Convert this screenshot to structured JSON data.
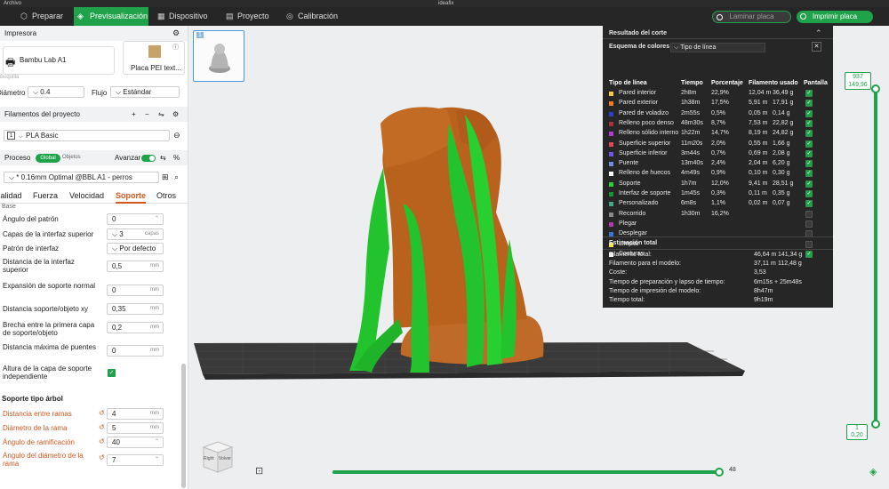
{
  "titlebar": {
    "archivo": "Archivo",
    "app": "ideafix"
  },
  "tabs": [
    {
      "label": "Preparar",
      "icon": "cube-icon"
    },
    {
      "label": "Previsualización",
      "icon": "preview-icon"
    },
    {
      "label": "Dispositivo",
      "icon": "device-icon"
    },
    {
      "label": "Proyecto",
      "icon": "project-icon"
    },
    {
      "label": "Calibración",
      "icon": "calibration-icon"
    }
  ],
  "actions": {
    "slice": "Laminar placa",
    "print": "Imprimir placa"
  },
  "printer": {
    "section": "Impresora",
    "name": "Bambu Lab A1",
    "plate": "Placa PEI text...",
    "nozzle_label": "Diámetro",
    "nozzle_value": "0.4",
    "flow_label": "Flujo",
    "flow_value": "Estándar",
    "boquilla": "Boquilla"
  },
  "filaments": {
    "section": "Filamentos del proyecto",
    "item_num": "1",
    "item": "PLA Basic"
  },
  "process": {
    "section": "Proceso",
    "global": "Global",
    "objects": "Objetos",
    "advanced": "Avanzar",
    "preset": "* 0.16mm Optimal @BBL A1 - perros",
    "tabs": [
      "Calidad",
      "Fuerza",
      "Velocidad",
      "Soporte",
      "Otros"
    ],
    "base": "Base",
    "fields": [
      {
        "label": "Ángulo del patrón",
        "value": "0",
        "unit": ""
      },
      {
        "label": "Capas de la interfaz superior",
        "value": "3",
        "unit": "capas"
      },
      {
        "label": "Patrón de interfaz",
        "value": "Por defecto",
        "unit": ""
      },
      {
        "label": "Distancia de la interfaz superior",
        "value": "0,5",
        "unit": "mm"
      },
      {
        "label": "Expansión de soporte normal",
        "value": "0",
        "unit": "mm"
      },
      {
        "label": "Distancia soporte/objeto xy",
        "value": "0,35",
        "unit": "mm"
      },
      {
        "label": "Brecha entre la primera capa de soporte/objeto",
        "value": "0,2",
        "unit": "mm"
      },
      {
        "label": "Distancia máxima de puentes",
        "value": "0",
        "unit": "mm"
      },
      {
        "label": "Altura de la capa de soporte independiente",
        "value": "",
        "unit": ""
      }
    ],
    "tree_section": "Soporte tipo árbol",
    "tree": [
      {
        "label": "Distancia entre ramas",
        "value": "4",
        "unit": "mm"
      },
      {
        "label": "Diámetro de la rama",
        "value": "5",
        "unit": "mm"
      },
      {
        "label": "Ángulo de ramificación",
        "value": "40",
        "unit": "°"
      },
      {
        "label": "Ángulo del diámetro de la rama",
        "value": "7",
        "unit": "°"
      }
    ]
  },
  "plate_num": "1",
  "cube": {
    "right": "Right",
    "volver": "Volver"
  },
  "result": {
    "title": "Resultado del corte",
    "scheme_label": "Esquema de colores",
    "scheme_value": "Tipo de línea",
    "columns": [
      "Tipo de línea",
      "Tiempo",
      "Porcentaje",
      "Filamento usado",
      "Pantalla"
    ],
    "rows": [
      {
        "name": "Pared interior",
        "time": "2h8m",
        "pct": "22,9%",
        "len": "12,04 m",
        "g": "36,49 g",
        "color": "#f5c842",
        "on": true
      },
      {
        "name": "Pared exterior",
        "time": "1h38m",
        "pct": "17,5%",
        "len": "5,91 m",
        "g": "17,91 g",
        "color": "#f07c24",
        "on": true
      },
      {
        "name": "Pared de voladizo",
        "time": "2m55s",
        "pct": "0,5%",
        "len": "0,05 m",
        "g": "0,14 g",
        "color": "#2c3fc7",
        "on": true
      },
      {
        "name": "Relleno poco denso",
        "time": "48m30s",
        "pct": "8,7%",
        "len": "7,53 m",
        "g": "22,82 g",
        "color": "#a8323a",
        "on": true
      },
      {
        "name": "Relleno sólido interno",
        "time": "1h22m",
        "pct": "14,7%",
        "len": "8,19 m",
        "g": "24,82 g",
        "color": "#b23bd1",
        "on": true
      },
      {
        "name": "Superficie superior",
        "time": "11m20s",
        "pct": "2,0%",
        "len": "0,55 m",
        "g": "1,66 g",
        "color": "#e0495a",
        "on": true
      },
      {
        "name": "Superficie inferior",
        "time": "3m44s",
        "pct": "0,7%",
        "len": "0,69 m",
        "g": "2,08 g",
        "color": "#7057e3",
        "on": true
      },
      {
        "name": "Puente",
        "time": "13m40s",
        "pct": "2,4%",
        "len": "2,04 m",
        "g": "6,20 g",
        "color": "#6f8fdc",
        "on": true
      },
      {
        "name": "Relleno de huecos",
        "time": "4m49s",
        "pct": "0,9%",
        "len": "0,10 m",
        "g": "0,30 g",
        "color": "#ffffff",
        "on": true
      },
      {
        "name": "Soporte",
        "time": "1h7m",
        "pct": "12,0%",
        "len": "9,41 m",
        "g": "28,51 g",
        "color": "#2fcc3a",
        "on": true
      },
      {
        "name": "Interfaz de soporte",
        "time": "1m45s",
        "pct": "0,3%",
        "len": "0,11 m",
        "g": "0,35 g",
        "color": "#1f8f3a",
        "on": true
      },
      {
        "name": "Personalizado",
        "time": "6m8s",
        "pct": "1,1%",
        "len": "0,02 m",
        "g": "0,07 g",
        "color": "#4aa38a",
        "on": true
      },
      {
        "name": "Recorrido",
        "time": "1h30m",
        "pct": "16,2%",
        "len": "",
        "g": "",
        "color": "#8a8a8a",
        "on": false
      },
      {
        "name": "Plegar",
        "time": "",
        "pct": "",
        "len": "",
        "g": "",
        "color": "#b03cb0",
        "on": false
      },
      {
        "name": "Desplegar",
        "time": "",
        "pct": "",
        "len": "",
        "g": "",
        "color": "#3b76d1",
        "on": false
      },
      {
        "name": "Limpiar",
        "time": "",
        "pct": "",
        "len": "",
        "g": "",
        "color": "#f5e642",
        "on": false
      },
      {
        "name": "Costuras",
        "time": "",
        "pct": "",
        "len": "",
        "g": "",
        "color": "#f0f0f0",
        "on": true
      }
    ],
    "summary_title": "Estimación total",
    "summary": [
      {
        "k": "Filamento total:",
        "v": "46,64 m",
        "v2": "141,34 g"
      },
      {
        "k": "Filamento para el modelo:",
        "v": "37,11 m",
        "v2": "112,48 g"
      },
      {
        "k": "Coste:",
        "v": "3,53",
        "v2": ""
      },
      {
        "k": "Tiempo de preparación y lapso de tiempo:",
        "v": "6m15s + 25m48s",
        "v2": ""
      },
      {
        "k": "Tiempo de impresión del modelo:",
        "v": "8h47m",
        "v2": ""
      },
      {
        "k": "Tiempo total:",
        "v": "9h19m",
        "v2": ""
      }
    ]
  },
  "layers": {
    "top_layer": "937",
    "top_height": "149,96",
    "bottom_layer": "1",
    "bottom_height": "0,20",
    "moves": "48"
  }
}
